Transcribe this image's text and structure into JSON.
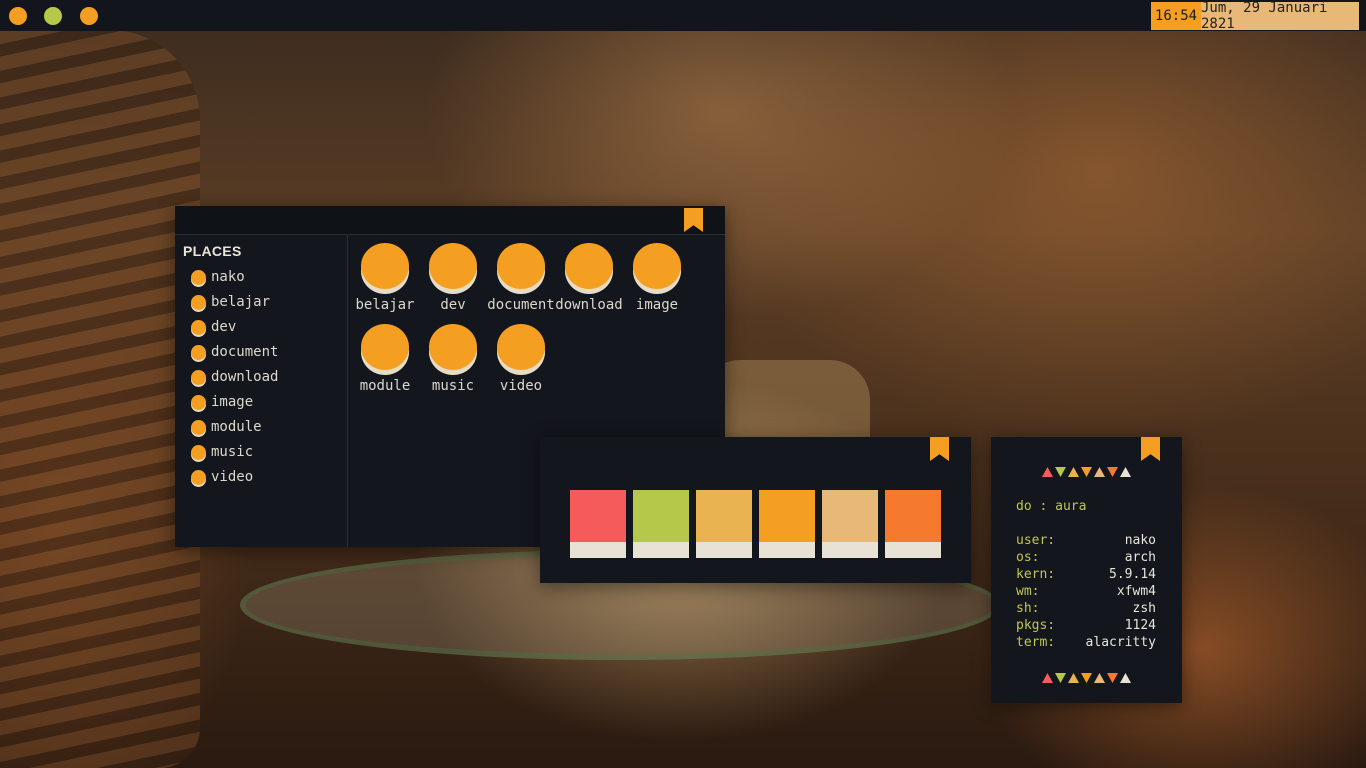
{
  "topbar": {
    "workspaces": [
      {
        "name": "workspace-1",
        "color": "#f59f22"
      },
      {
        "name": "workspace-2",
        "color": "#b6c84a"
      },
      {
        "name": "workspace-3",
        "color": "#f59f22"
      }
    ],
    "time": "16:54",
    "date": "Jum, 29 Januari 2821"
  },
  "file_manager": {
    "places_title": "PLACES",
    "places": [
      "nako",
      "belajar",
      "dev",
      "document",
      "download",
      "image",
      "module",
      "music",
      "video"
    ],
    "folders": [
      "belajar",
      "dev",
      "document",
      "download",
      "image",
      "module",
      "music",
      "video"
    ]
  },
  "palette": {
    "colors": [
      "#f65b5b",
      "#b6c84a",
      "#e8b350",
      "#f59f22",
      "#e8b878",
      "#f57a2e"
    ]
  },
  "sysinfo": {
    "greeting": "do : aura",
    "triangles_top": [
      {
        "dir": "up",
        "color": "#f65b5b"
      },
      {
        "dir": "down",
        "color": "#b6c84a"
      },
      {
        "dir": "up",
        "color": "#e8b350"
      },
      {
        "dir": "down",
        "color": "#f59f22"
      },
      {
        "dir": "up",
        "color": "#e8b878"
      },
      {
        "dir": "down",
        "color": "#f57a2e"
      },
      {
        "dir": "up",
        "color": "#e8e2d4"
      }
    ],
    "triangles_bottom": [
      {
        "dir": "up",
        "color": "#f65b5b"
      },
      {
        "dir": "down",
        "color": "#b6c84a"
      },
      {
        "dir": "up",
        "color": "#e8b350"
      },
      {
        "dir": "down",
        "color": "#f59f22"
      },
      {
        "dir": "up",
        "color": "#e8b878"
      },
      {
        "dir": "down",
        "color": "#f57a2e"
      },
      {
        "dir": "up",
        "color": "#e8e2d4"
      }
    ],
    "rows": [
      {
        "key": "user:",
        "value": "nako"
      },
      {
        "key": "os:",
        "value": "arch"
      },
      {
        "key": "kern:",
        "value": "5.9.14"
      },
      {
        "key": "wm:",
        "value": "xfwm4"
      },
      {
        "key": "sh:",
        "value": "zsh"
      },
      {
        "key": "pkgs:",
        "value": "1124"
      },
      {
        "key": "term:",
        "value": "alacritty"
      }
    ]
  },
  "icons": {
    "ribbon": "bookmark-icon",
    "place": "folder-icon",
    "folder": "folder-icon"
  },
  "accent_color": "#f59f22"
}
